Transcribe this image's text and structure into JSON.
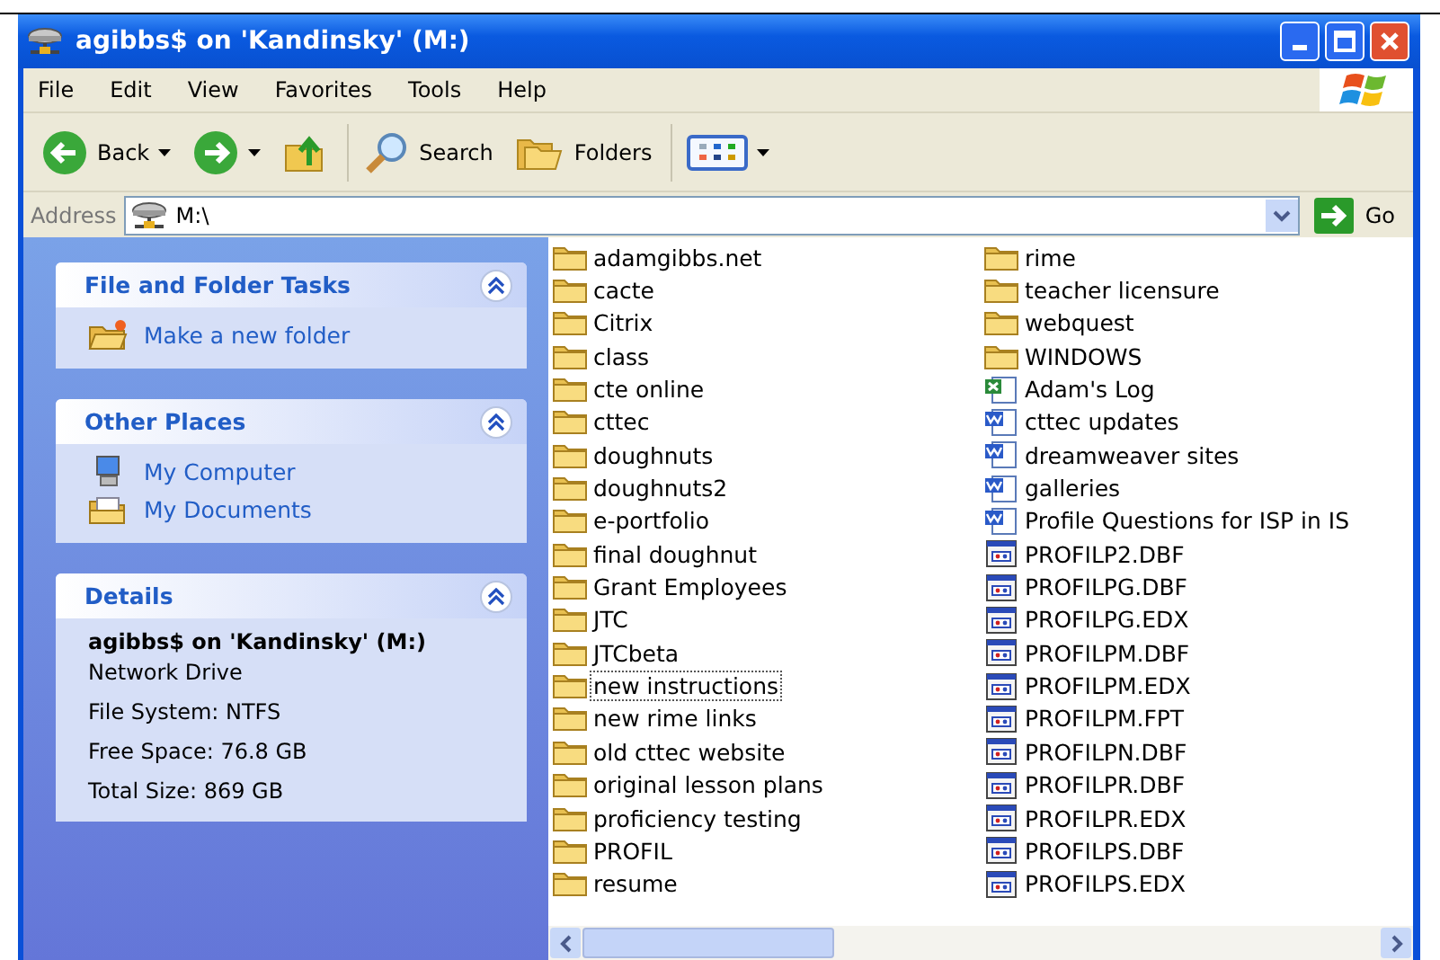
{
  "window": {
    "title": "agibbs$ on 'Kandinsky' (M:)"
  },
  "menu": [
    "File",
    "Edit",
    "View",
    "Favorites",
    "Tools",
    "Help"
  ],
  "toolbar": [
    {
      "kind": "back",
      "label": "Back"
    },
    {
      "kind": "forward"
    },
    {
      "kind": "up"
    },
    {
      "kind": "search",
      "label": "Search"
    },
    {
      "kind": "folders",
      "label": "Folders"
    },
    {
      "kind": "views"
    }
  ],
  "address": {
    "label": "Address",
    "value": "M:\\",
    "go": "Go"
  },
  "panels": [
    {
      "kind": "links",
      "title": "File and Folder Tasks",
      "expanded": true,
      "links": [
        {
          "kind": "folder",
          "label": "Make a new folder"
        }
      ]
    },
    {
      "kind": "links",
      "title": "Other Places",
      "expanded": true,
      "links": [
        {
          "kind": "computer",
          "label": "My Computer"
        },
        {
          "kind": "documents",
          "label": "My Documents"
        }
      ]
    },
    {
      "kind": "details",
      "title": "Details",
      "expanded": true,
      "name": "agibbs$ on 'Kandinsky' (M:)",
      "lines": [
        "Network Drive",
        "File System: NTFS",
        "Free Space: 76.8 GB",
        "Total Size: 869 GB"
      ]
    }
  ],
  "files": [
    {
      "kind": "folder",
      "name": "adamgibbs.net",
      "focused": false
    },
    {
      "kind": "folder",
      "name": "cacte",
      "focused": false
    },
    {
      "kind": "folder",
      "name": "Citrix",
      "focused": false
    },
    {
      "kind": "folder",
      "name": "class",
      "focused": false
    },
    {
      "kind": "folder",
      "name": "cte online",
      "focused": false
    },
    {
      "kind": "folder",
      "name": "cttec",
      "focused": false
    },
    {
      "kind": "folder",
      "name": "doughnuts",
      "focused": false
    },
    {
      "kind": "folder",
      "name": "doughnuts2",
      "focused": false
    },
    {
      "kind": "folder",
      "name": "e-portfolio",
      "focused": false
    },
    {
      "kind": "folder",
      "name": "final doughnut",
      "focused": false
    },
    {
      "kind": "folder",
      "name": "Grant Employees",
      "focused": false
    },
    {
      "kind": "folder",
      "name": "JTC",
      "focused": false
    },
    {
      "kind": "folder",
      "name": "JTCbeta",
      "focused": false
    },
    {
      "kind": "folder",
      "name": "new instructions",
      "focused": true
    },
    {
      "kind": "folder",
      "name": "new rime links",
      "focused": false
    },
    {
      "kind": "folder",
      "name": "old cttec website",
      "focused": false
    },
    {
      "kind": "folder",
      "name": "original lesson plans",
      "focused": false
    },
    {
      "kind": "folder",
      "name": "proficiency testing",
      "focused": false
    },
    {
      "kind": "folder",
      "name": "PROFIL",
      "focused": false
    },
    {
      "kind": "folder",
      "name": "resume",
      "focused": false
    },
    {
      "kind": "folder",
      "name": "rime",
      "focused": false
    },
    {
      "kind": "folder",
      "name": "teacher licensure",
      "focused": false
    },
    {
      "kind": "folder",
      "name": "webquest",
      "focused": false
    },
    {
      "kind": "folder",
      "name": "WINDOWS",
      "focused": false
    },
    {
      "kind": "spreadsheet",
      "name": "Adam's Log",
      "focused": false
    },
    {
      "kind": "word",
      "name": "cttec updates",
      "focused": false
    },
    {
      "kind": "word",
      "name": "dreamweaver sites",
      "focused": false
    },
    {
      "kind": "word",
      "name": "galleries",
      "focused": false
    },
    {
      "kind": "word",
      "name": "Profile Questions for ISP in IS",
      "focused": false
    },
    {
      "kind": "database",
      "name": "PROFILP2.DBF",
      "focused": false
    },
    {
      "kind": "database",
      "name": "PROFILPG.DBF",
      "focused": false
    },
    {
      "kind": "database",
      "name": "PROFILPG.EDX",
      "focused": false
    },
    {
      "kind": "database",
      "name": "PROFILPM.DBF",
      "focused": false
    },
    {
      "kind": "database",
      "name": "PROFILPM.EDX",
      "focused": false
    },
    {
      "kind": "database",
      "name": "PROFILPM.FPT",
      "focused": false
    },
    {
      "kind": "database",
      "name": "PROFILPN.DBF",
      "focused": false
    },
    {
      "kind": "database",
      "name": "PROFILPR.DBF",
      "focused": false
    },
    {
      "kind": "database",
      "name": "PROFILPR.EDX",
      "focused": false
    },
    {
      "kind": "database",
      "name": "PROFILPS.DBF",
      "focused": false
    },
    {
      "kind": "database",
      "name": "PROFILPS.EDX",
      "focused": false
    }
  ]
}
